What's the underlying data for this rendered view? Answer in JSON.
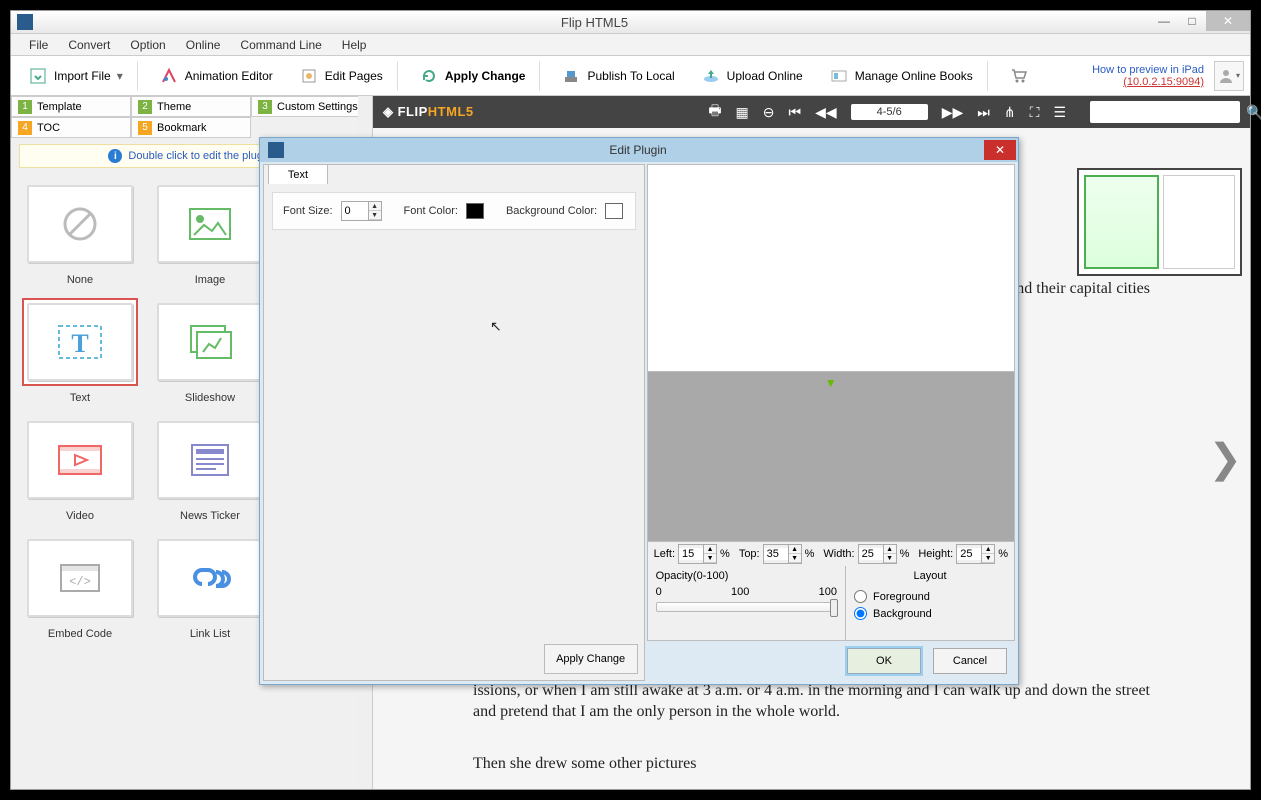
{
  "titlebar": {
    "title": "Flip HTML5"
  },
  "winbtns": {
    "min": "—",
    "max": "□",
    "close": "✕"
  },
  "menu": [
    "File",
    "Convert",
    "Option",
    "Online",
    "Command Line",
    "Help"
  ],
  "toolbar": {
    "import": "Import File",
    "anim": "Animation Editor",
    "editpages": "Edit Pages",
    "apply": "Apply Change",
    "publish": "Publish To Local",
    "upload": "Upload Online",
    "manage": "Manage Online Books"
  },
  "preview_link": {
    "text": "How to preview in iPad",
    "ip": "(10.0.2.15:9094)"
  },
  "panel_tabs": {
    "template": {
      "n": "1",
      "label": "Template"
    },
    "theme": {
      "n": "2",
      "label": "Theme"
    },
    "custom": {
      "n": "3",
      "label": "Custom Settings"
    },
    "toc": {
      "n": "4",
      "label": "TOC"
    },
    "bookmark": {
      "n": "5",
      "label": "Bookmark"
    }
  },
  "hint": "Double click to edit the plugin.",
  "plugins": {
    "none": "None",
    "image": "Image",
    "text": "Text",
    "slideshow": "Slideshow",
    "video": "Video",
    "news": "News Ticker",
    "embed": "Embed Code",
    "link": "Link List"
  },
  "viewer": {
    "logo_a": "FLIP",
    "logo_b": "HTML5",
    "page": "4-5/6",
    "body1": "and their capital cities",
    "body2": "issions, or when I am still awake at 3 a.m. or 4 a.m. in the morning and I can walk up and down the street and pretend that I am the only person in the whole world.",
    "body3": "Then she drew some other pictures"
  },
  "dialog": {
    "title": "Edit Plugin",
    "tab": "Text",
    "font_size_label": "Font Size:",
    "font_size": "0",
    "font_color_label": "Font Color:",
    "font_color": "#000000",
    "bg_color_label": "Background Color:",
    "bg_color": "#ffffff",
    "apply": "Apply Change",
    "pos": {
      "left_label": "Left:",
      "left": "15",
      "top_label": "Top:",
      "top": "35",
      "width_label": "Width:",
      "width": "25",
      "height_label": "Height:",
      "height": "25",
      "pct": "%"
    },
    "opacity": {
      "label": "Opacity(0-100)",
      "min": "0",
      "mid": "100",
      "val": "100"
    },
    "layout": {
      "label": "Layout",
      "fg": "Foreground",
      "bg": "Background"
    },
    "ok": "OK",
    "cancel": "Cancel"
  }
}
